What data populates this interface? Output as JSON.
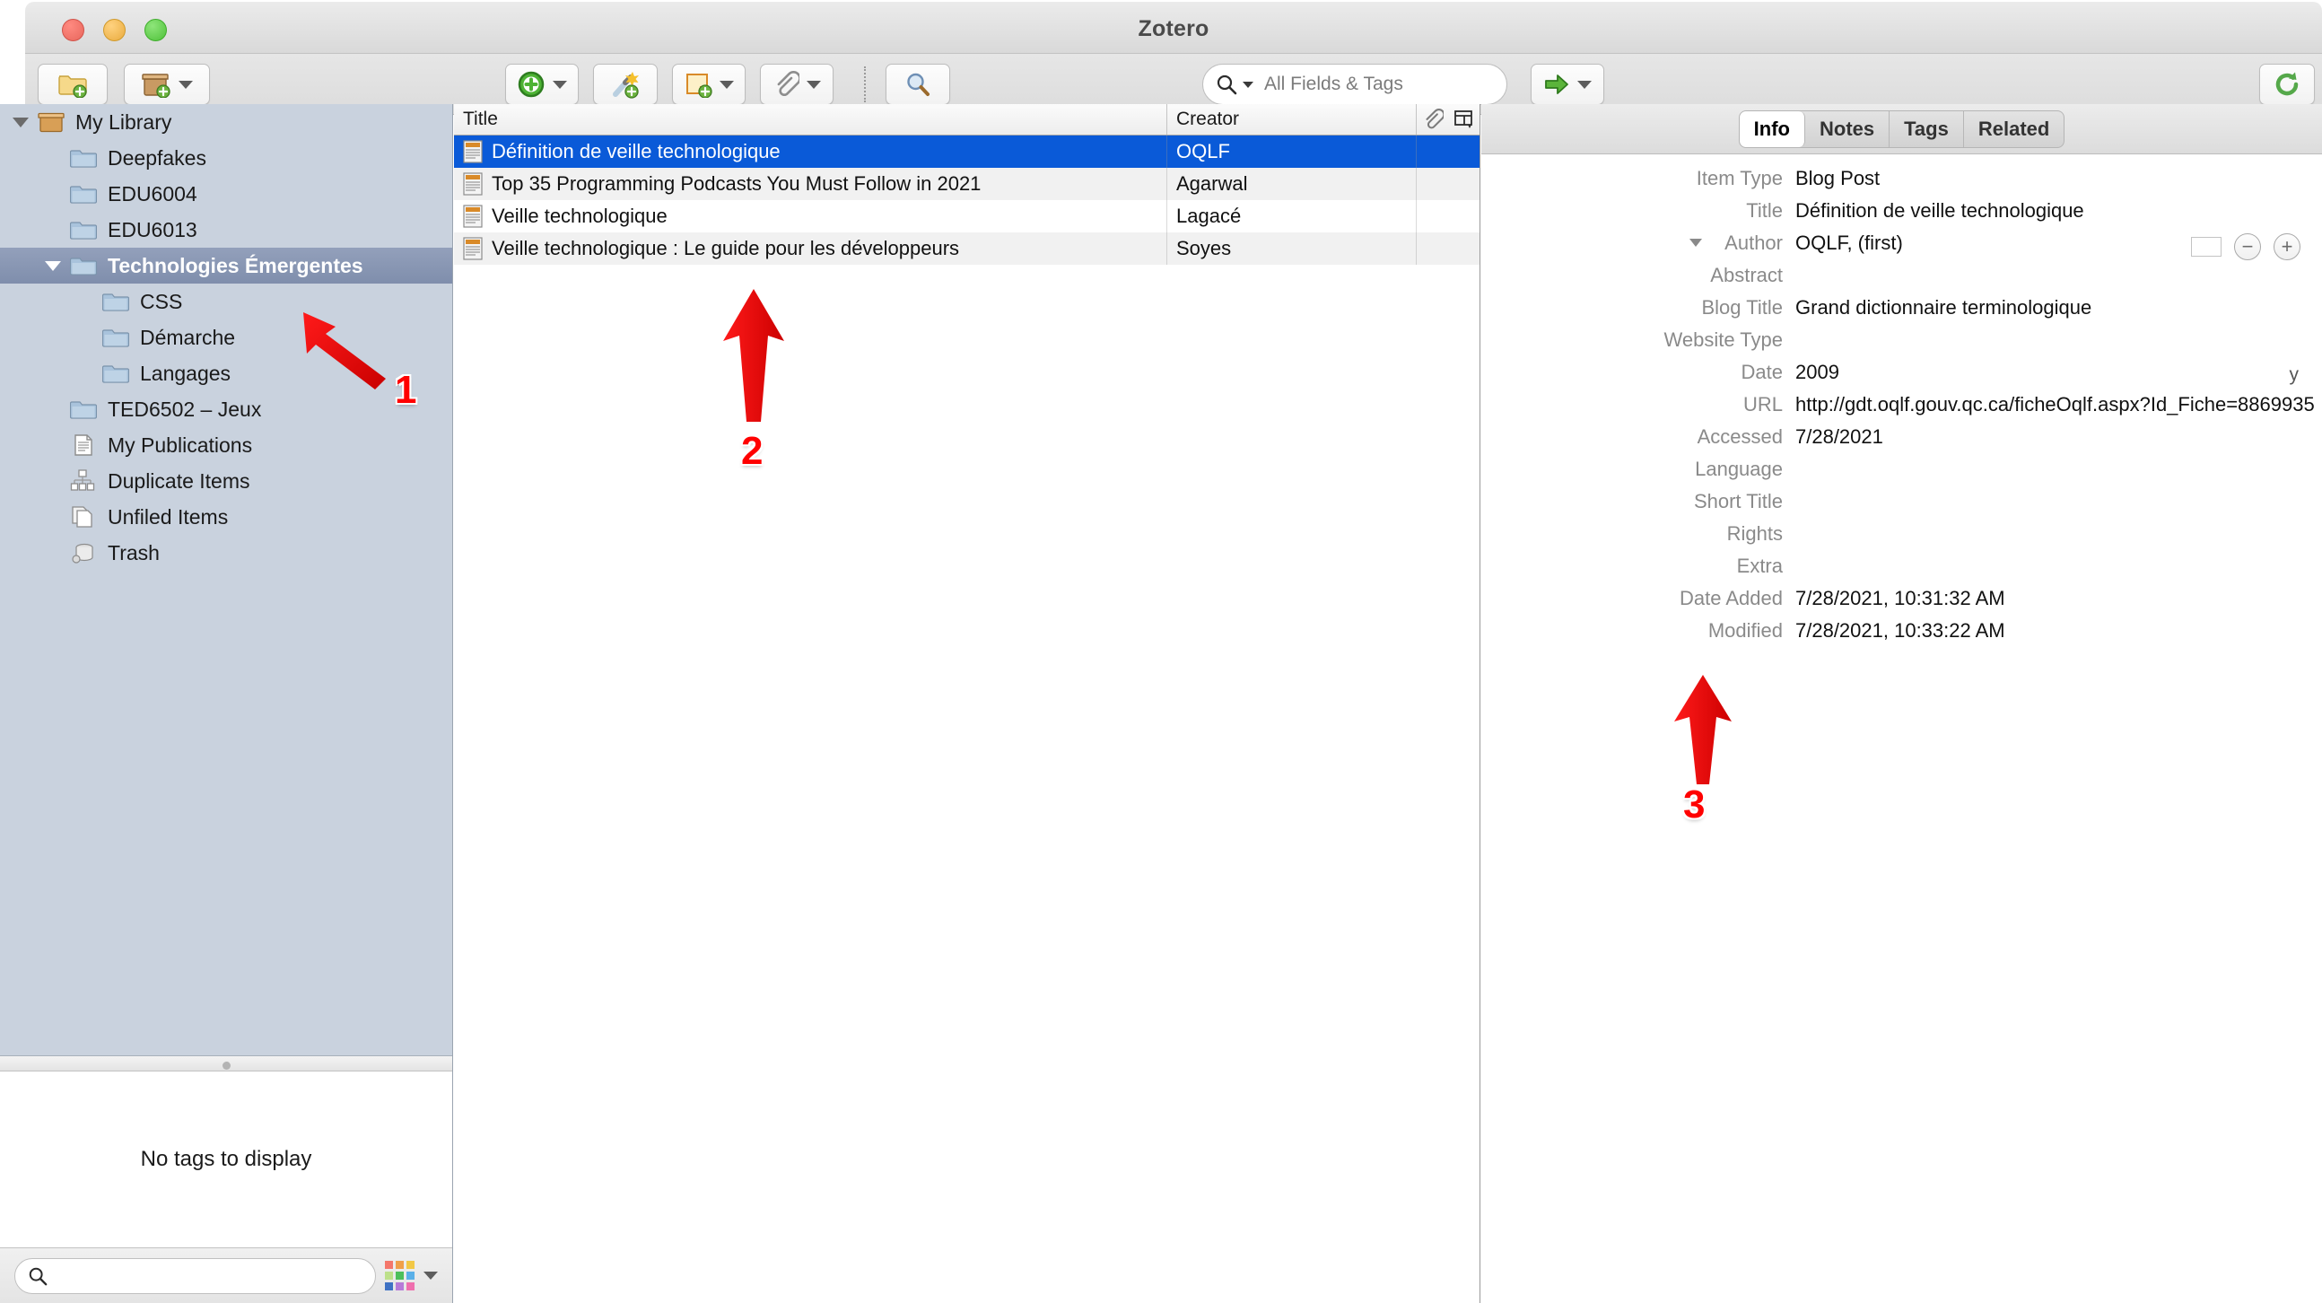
{
  "window": {
    "title": "Zotero",
    "traffic_lights": [
      "close",
      "minimize",
      "maximize"
    ]
  },
  "toolbar": {
    "new_collection_label": "new-collection",
    "new_library_label": "new-library",
    "new_item_label": "new-item",
    "add_by_identifier_label": "add-by-identifier",
    "new_note_label": "new-note",
    "add_attachment_label": "add-attachment",
    "advanced_search_label": "advanced-search",
    "locate_label": "locate",
    "sync_label": "sync"
  },
  "search": {
    "placeholder": "All Fields & Tags",
    "value": ""
  },
  "sidebar": {
    "items": [
      {
        "label": "My Library",
        "icon": "library-icon",
        "indent": 0,
        "twisty": "down",
        "selected": false
      },
      {
        "label": "Deepfakes",
        "icon": "folder-icon",
        "indent": 1,
        "twisty": "none",
        "selected": false
      },
      {
        "label": "EDU6004",
        "icon": "folder-icon",
        "indent": 1,
        "twisty": "none",
        "selected": false
      },
      {
        "label": "EDU6013",
        "icon": "folder-icon",
        "indent": 1,
        "twisty": "none",
        "selected": false
      },
      {
        "label": "Technologies Émergentes",
        "icon": "folder-icon",
        "indent": 1,
        "twisty": "down",
        "selected": true
      },
      {
        "label": "CSS",
        "icon": "folder-icon",
        "indent": 2,
        "twisty": "none",
        "selected": false
      },
      {
        "label": "Démarche",
        "icon": "folder-icon",
        "indent": 2,
        "twisty": "none",
        "selected": false
      },
      {
        "label": "Langages",
        "icon": "folder-icon",
        "indent": 2,
        "twisty": "none",
        "selected": false
      },
      {
        "label": "TED6502 – Jeux",
        "icon": "folder-icon",
        "indent": 1,
        "twisty": "none",
        "selected": false
      },
      {
        "label": "My Publications",
        "icon": "document-icon",
        "indent": 1,
        "twisty": "none",
        "selected": false
      },
      {
        "label": "Duplicate Items",
        "icon": "duplicates-icon",
        "indent": 1,
        "twisty": "none",
        "selected": false
      },
      {
        "label": "Unfiled Items",
        "icon": "unfiled-icon",
        "indent": 1,
        "twisty": "none",
        "selected": false
      },
      {
        "label": "Trash",
        "icon": "trash-icon",
        "indent": 1,
        "twisty": "none",
        "selected": false
      }
    ]
  },
  "tag_selector": {
    "empty_message": "No tags to display",
    "search_placeholder": "",
    "search_value": "",
    "swatch_colors": [
      "#f4776b",
      "#f0a04a",
      "#f2c846",
      "#bde08a",
      "#4cbf5b",
      "#5ab0e8",
      "#3f72c4",
      "#b77ad8",
      "#ef6fae"
    ]
  },
  "items_list": {
    "columns": [
      "Title",
      "Creator"
    ],
    "rows": [
      {
        "title": "Définition de veille technologique",
        "creator": "OQLF",
        "selected": true
      },
      {
        "title": "Top 35 Programming Podcasts You Must Follow in 2021",
        "creator": "Agarwal",
        "selected": false
      },
      {
        "title": "Veille technologique",
        "creator": "Lagacé",
        "selected": false
      },
      {
        "title": "Veille technologique : Le guide pour les développeurs",
        "creator": "Soyes",
        "selected": false
      }
    ],
    "attachment_column_icon": "paperclip-icon",
    "column_picker_icon": "column-picker-icon"
  },
  "right_panel": {
    "tabs": [
      {
        "label": "Info",
        "active": true
      },
      {
        "label": "Notes",
        "active": false
      },
      {
        "label": "Tags",
        "active": false
      },
      {
        "label": "Related",
        "active": false
      }
    ],
    "fields": [
      {
        "label": "Item Type",
        "value": "Blog Post"
      },
      {
        "label": "Title",
        "value": "Définition de veille technologique"
      },
      {
        "label": "Author",
        "value": "OQLF, (first)",
        "twisty": true,
        "extras": true
      },
      {
        "label": "Abstract",
        "value": ""
      },
      {
        "label": "Blog Title",
        "value": "Grand dictionnaire terminologique"
      },
      {
        "label": "Website Type",
        "value": ""
      },
      {
        "label": "Date",
        "value": "2009",
        "year_hint": "y"
      },
      {
        "label": "URL",
        "value": "http://gdt.oqlf.gouv.qc.ca/ficheOqlf.aspx?Id_Fiche=8869935"
      },
      {
        "label": "Accessed",
        "value": "7/28/2021"
      },
      {
        "label": "Language",
        "value": ""
      },
      {
        "label": "Short Title",
        "value": ""
      },
      {
        "label": "Rights",
        "value": ""
      },
      {
        "label": "Extra",
        "value": ""
      },
      {
        "label": "Date Added",
        "value": "7/28/2021, 10:31:32 AM"
      },
      {
        "label": "Modified",
        "value": "7/28/2021, 10:33:22 AM"
      }
    ],
    "author_minus_label": "−",
    "author_plus_label": "+"
  },
  "annotations": [
    {
      "number": "1",
      "direction": "up-left"
    },
    {
      "number": "2",
      "direction": "up"
    },
    {
      "number": "3",
      "direction": "up"
    }
  ],
  "colors": {
    "selection_blue": "#0a5ad8",
    "collection_selected": "#7f8eac",
    "annotation_red": "#ff0000",
    "sidebar_bg": "#c9d2de"
  }
}
